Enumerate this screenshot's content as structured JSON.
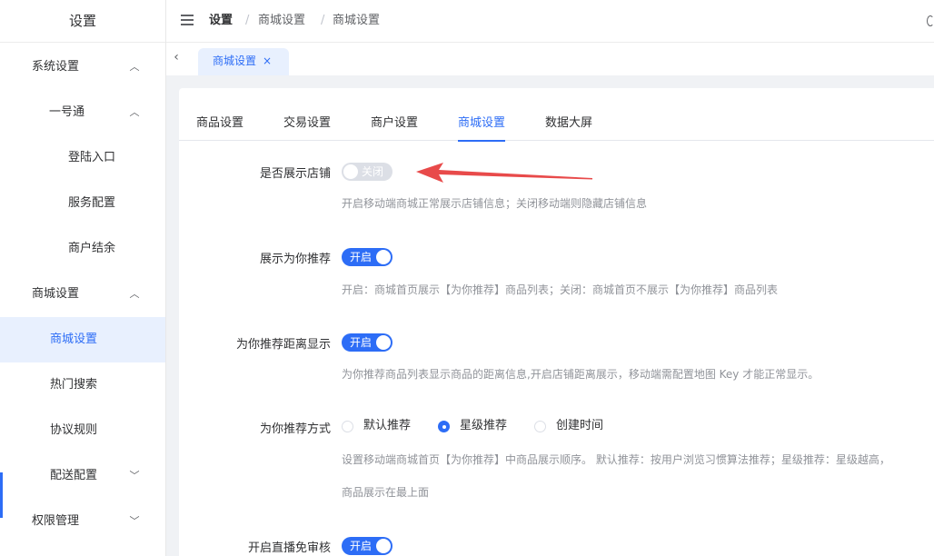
{
  "sidebar": {
    "title": "设置",
    "items": [
      {
        "label": "系统设置",
        "arrow": "up"
      },
      {
        "label": "一号通",
        "arrow": "up"
      },
      {
        "label": "登陆入口"
      },
      {
        "label": "服务配置"
      },
      {
        "label": "商户结余"
      },
      {
        "label": "商城设置",
        "arrow": "up"
      },
      {
        "label": "商城设置",
        "active": true
      },
      {
        "label": "热门搜索"
      },
      {
        "label": "协议规则"
      },
      {
        "label": "配送配置",
        "arrow": "down"
      },
      {
        "label": "权限管理",
        "arrow": "down"
      }
    ]
  },
  "header": {
    "breadcrumb": [
      "设置",
      "/",
      "商城设置",
      "/",
      "商城设置"
    ]
  },
  "tagbar": {
    "tag_label": "商城设置",
    "close": "×",
    "back": "‹"
  },
  "tabs": [
    "商品设置",
    "交易设置",
    "商户设置",
    "商城设置",
    "数据大屏"
  ],
  "active_tab": "商城设置",
  "form": {
    "show_store": {
      "label": "是否展示店铺",
      "switch_text": "关闭",
      "state": "off",
      "hint": "开启移动端商城正常展示店铺信息；关闭移动端则隐藏店铺信息"
    },
    "recommend": {
      "label": "展示为你推荐",
      "switch_text": "开启",
      "state": "on",
      "hint": "开启：商城首页展示【为你推荐】商品列表；关闭：商城首页不展示【为你推荐】商品列表"
    },
    "distance": {
      "label": "为你推荐距离显示",
      "switch_text": "开启",
      "state": "on",
      "hint": "为你推荐商品列表显示商品的距离信息,开启店铺距离展示，移动端需配置地图 Key 才能正常显示。"
    },
    "method": {
      "label": "为你推荐方式",
      "options": [
        "默认推荐",
        "星级推荐",
        "创建时间"
      ],
      "selected": "星级推荐",
      "hint_line1": "设置移动端商城首页【为你推荐】中商品展示顺序。 默认推荐：按用户浏览习惯算法推荐；星级推荐：星级越高，",
      "hint_line2": "商品展示在最上面"
    },
    "live": {
      "label": "开启直播免审核",
      "switch_text": "开启",
      "state": "on"
    }
  },
  "colors": {
    "accent": "#2d6df6",
    "arrow": "#e84a4a"
  }
}
